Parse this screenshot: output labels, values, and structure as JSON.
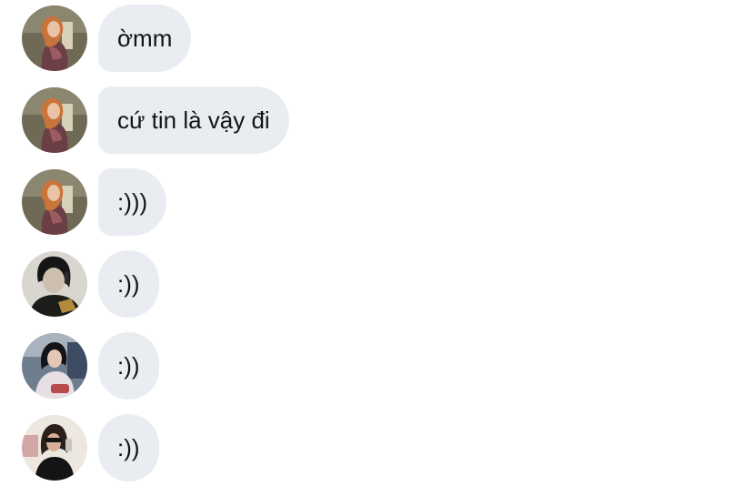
{
  "messages": [
    {
      "sender": "user-a",
      "text": "ờmm"
    },
    {
      "sender": "user-a",
      "text": "cứ tin là vậy đi"
    },
    {
      "sender": "user-a",
      "text": ":)))"
    },
    {
      "sender": "user-b",
      "text": ":))"
    },
    {
      "sender": "user-c",
      "text": ":))"
    },
    {
      "sender": "user-d",
      "text": ":))"
    }
  ]
}
